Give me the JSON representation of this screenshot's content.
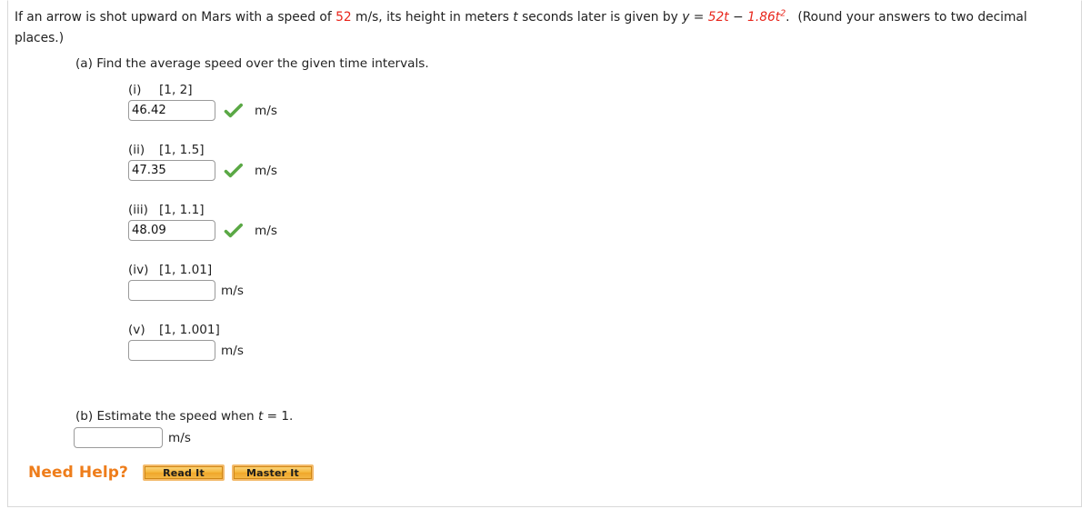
{
  "problem": {
    "intro_before_speed": "If an arrow is shot upward on Mars with a speed of ",
    "speed_value": "52",
    "intro_after_speed": " m/s, its height in meters ",
    "time_var": "t",
    "intro_after_var": " seconds later is given by ",
    "eq_lhs": "y",
    "eq_equals": " = ",
    "eq_term1": "52t",
    "eq_minus": " − ",
    "eq_term2": "1.86t",
    "eq_exponent": "2",
    "eq_period": ".",
    "rounding_note": "(Round your answers to two decimal places.)"
  },
  "part_a": {
    "prompt": "(a) Find the average speed over the given time intervals.",
    "items": [
      {
        "roman": "(i)",
        "interval": "[1, 2]",
        "value": "46.42",
        "unit": "m/s",
        "correct": true
      },
      {
        "roman": "(ii)",
        "interval": "[1, 1.5]",
        "value": "47.35",
        "unit": "m/s",
        "correct": true
      },
      {
        "roman": "(iii)",
        "interval": "[1, 1.1]",
        "value": "48.09",
        "unit": "m/s",
        "correct": true
      },
      {
        "roman": "(iv)",
        "interval": "[1, 1.01]",
        "value": "",
        "unit": "m/s",
        "correct": false
      },
      {
        "roman": "(v)",
        "interval": "[1, 1.001]",
        "value": "",
        "unit": "m/s",
        "correct": false
      }
    ]
  },
  "part_b": {
    "prompt_before": "(b) Estimate the speed when ",
    "prompt_var": "t",
    "prompt_after": " = 1.",
    "value": "",
    "unit": "m/s"
  },
  "help": {
    "label": "Need Help?",
    "buttons": [
      {
        "label": "Read It"
      },
      {
        "label": "Master It"
      }
    ]
  },
  "colors": {
    "accent_red": "#e8261c",
    "help_orange": "#ee7d1b",
    "check_green": "#5aa845"
  }
}
